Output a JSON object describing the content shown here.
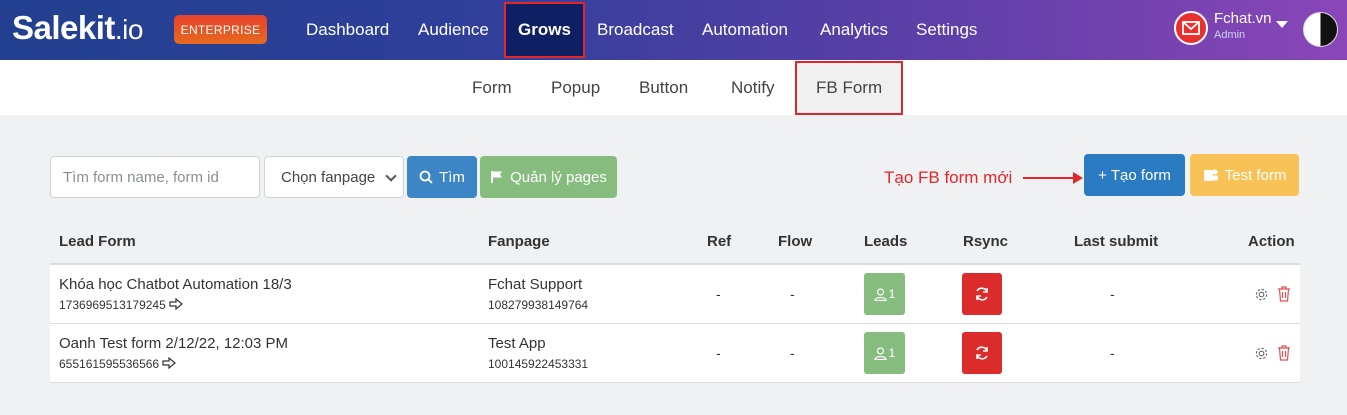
{
  "header": {
    "logo_main": "Salekit",
    "logo_suffix": ".io",
    "badge": "ENTERPRISE",
    "nav": [
      "Dashboard",
      "Audience",
      "Grows",
      "Broadcast",
      "Automation",
      "Analytics",
      "Settings"
    ],
    "active_nav": "Grows",
    "user_name": "Fchat.vn",
    "user_role": "Admin"
  },
  "subnav": {
    "items": [
      "Form",
      "Popup",
      "Button",
      "Notify",
      "FB Form"
    ],
    "active": "FB Form"
  },
  "toolbar": {
    "search_placeholder": "Tìm form name, form id",
    "fanpage_select": "Chọn fanpage",
    "search_button": "Tìm",
    "manage_pages_button": "Quản lý pages",
    "annotation": "Tạo FB form mới",
    "create_button": "+ Tạo form",
    "test_button": "Test form"
  },
  "table": {
    "headers": [
      "Lead Form",
      "Fanpage",
      "Ref",
      "Flow",
      "Leads",
      "Rsync",
      "Last submit",
      "Action"
    ],
    "rows": [
      {
        "form_name": "Khóa học Chatbot Automation 18/3",
        "form_id": "1736969513179245",
        "fanpage": "Fchat Support",
        "page_id": "108279938149764",
        "ref": "-",
        "flow": "-",
        "leads": "1",
        "last_submit": "-"
      },
      {
        "form_name": "Oanh Test form 2/12/22, 12:03 PM",
        "form_id": "655161595536566",
        "fanpage": "Test App",
        "page_id": "100145922453331",
        "ref": "-",
        "flow": "-",
        "leads": "1",
        "last_submit": "-"
      }
    ]
  },
  "colors": {
    "accent_red": "#e0282b",
    "primary_blue": "#2b7bc2",
    "success_green": "#86bd7f",
    "warning_orange": "#f9c257",
    "danger_red": "#dc2b2b"
  }
}
